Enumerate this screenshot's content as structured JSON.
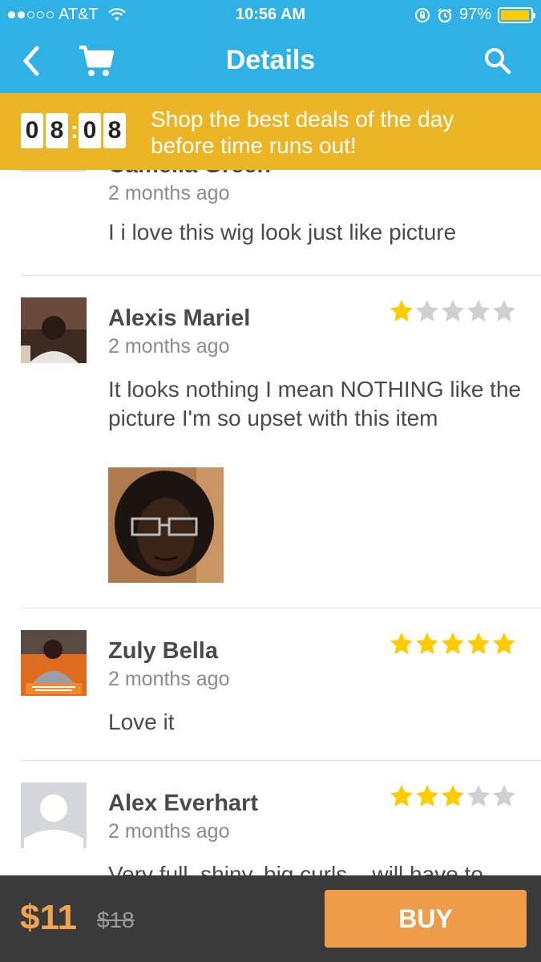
{
  "status_bar": {
    "carrier": "AT&T",
    "time": "10:56 AM",
    "battery": "97%",
    "battery_level": 0.97,
    "signal_filled": 2,
    "signal_total": 5,
    "icons": [
      "signal-icon",
      "wifi-icon",
      "rotation-lock-icon",
      "alarm-icon",
      "battery-icon"
    ]
  },
  "nav": {
    "title": "Details",
    "icons": [
      "back-chevron-icon",
      "cart-icon",
      "search-icon"
    ]
  },
  "deal_banner": {
    "countdown_digits": [
      "0",
      "8",
      "0",
      "8"
    ],
    "text": "Shop the best deals of the day before time runs out!"
  },
  "reviews": [
    {
      "name": "Camelia Green",
      "date": "2 months ago",
      "text": "I i love this wig look just like picture",
      "rating": null,
      "avatar": "placeholder-avatar-icon"
    },
    {
      "name": "Alexis Mariel",
      "date": "2 months ago",
      "text": "It looks nothing I mean NOTHING like the picture I'm so upset with this item",
      "rating": 1,
      "avatar": "user-photo",
      "has_photo": true
    },
    {
      "name": "Zuly Bella",
      "date": "2 months ago",
      "text": "Love it",
      "rating": 5,
      "avatar": "user-photo"
    },
    {
      "name": "Alex Everhart",
      "date": "2 months ago",
      "text": "Very full, shiny, big curls... will have to",
      "rating": 3,
      "avatar": "placeholder-avatar-icon"
    }
  ],
  "colors": {
    "primary": "#2fb1e6",
    "banner": "#ebb525",
    "star_on": "#ffcc00",
    "star_off": "#d0d0d0",
    "price": "#f0a350",
    "buy": "#ee9c49",
    "bottom_bar": "#3a3a3a"
  },
  "bottom_bar": {
    "price": "$11",
    "original_price": "$18",
    "buy_label": "BUY"
  }
}
